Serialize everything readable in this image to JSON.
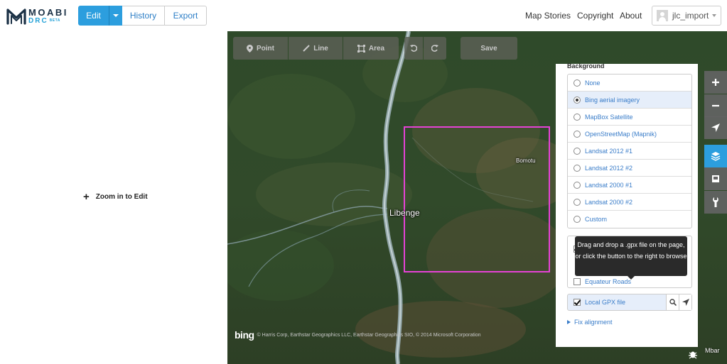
{
  "brand": {
    "name": "MOABI",
    "sub": "DRC",
    "beta": "BETA"
  },
  "header": {
    "edit_label": "Edit",
    "history_label": "History",
    "export_label": "Export",
    "links": [
      "Map Stories",
      "Copyright",
      "About"
    ],
    "username": "jlc_import"
  },
  "left": {
    "zoom_to_edit": "Zoom in to Edit"
  },
  "toolbar": {
    "point": "Point",
    "line": "Line",
    "area": "Area",
    "save": "Save"
  },
  "map": {
    "places": {
      "libenge": "Libenge",
      "bomotu": "Bomotu"
    },
    "attribution": "© Harris Corp, Earthstar Geographics LLC, Earthstar Geographics SIO, © 2014 Microsoft Corporation",
    "bing": "bing",
    "scale_text": "Mbar"
  },
  "background_pane": {
    "title": "Background",
    "layers": [
      {
        "label": "None",
        "selected": false
      },
      {
        "label": "Bing aerial imagery",
        "selected": true
      },
      {
        "label": "MapBox Satellite",
        "selected": false
      },
      {
        "label": "OpenStreetMap (Mapnik)",
        "selected": false
      },
      {
        "label": "Landsat 2012 #1",
        "selected": false
      },
      {
        "label": "Landsat 2012 #2",
        "selected": false
      },
      {
        "label": "Landsat 2000 #1",
        "selected": false
      },
      {
        "label": "Landsat 2000 #2",
        "selected": false
      },
      {
        "label": "Custom",
        "selected": false
      }
    ],
    "overlays": [
      {
        "label": "Equateur Roads",
        "checked": false
      }
    ],
    "tooltip": "Drag and drop a .gpx file on the page, or click the button to the right to browse",
    "gpx_label": "Local GPX file",
    "fix_alignment": "Fix alignment"
  },
  "colors": {
    "accent": "#2c9ede",
    "link": "#3a7dc9",
    "selection_box": "#e642d6"
  },
  "icons": {
    "zoom_in": "plus-icon",
    "zoom_out": "minus-icon",
    "geolocate": "location-arrow-icon",
    "background": "layers-icon",
    "map_data": "map-data-icon",
    "help": "wrench-icon"
  }
}
